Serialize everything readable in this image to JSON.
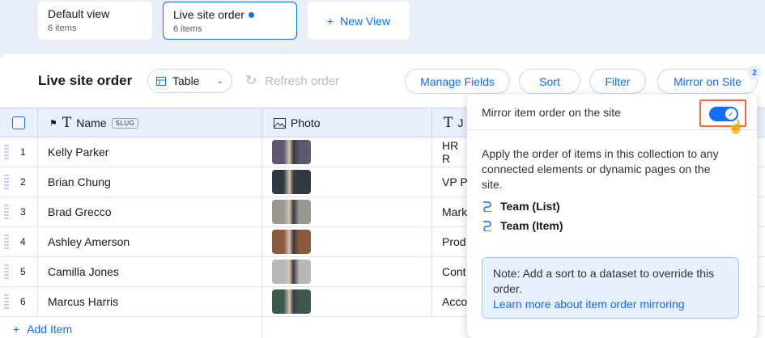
{
  "views": [
    {
      "name": "Default view",
      "count": "6 items",
      "active": false
    },
    {
      "name": "Live site order",
      "count": "6 items",
      "active": true
    }
  ],
  "new_view_label": "New View",
  "toolbar": {
    "title": "Live site order",
    "layout_select": "Table",
    "refresh_label": "Refresh order",
    "manage_fields": "Manage Fields",
    "sort": "Sort",
    "filter": "Filter",
    "mirror": "Mirror on Site",
    "mirror_badge": "2"
  },
  "columns": {
    "name": "Name",
    "slug_tag": "SLUG",
    "photo": "Photo",
    "third_partial": "J"
  },
  "rows": [
    {
      "num": "1",
      "name": "Kelly Parker",
      "third": "HR R",
      "photo_color": "#5d5770"
    },
    {
      "num": "2",
      "name": "Brian Chung",
      "third": "VP P",
      "photo_color": "#2f3a40"
    },
    {
      "num": "3",
      "name": "Brad Grecco",
      "third": "Mark",
      "photo_color": "#9a9690"
    },
    {
      "num": "4",
      "name": "Ashley Amerson",
      "third": "Prod",
      "photo_color": "#8a5a3c"
    },
    {
      "num": "5",
      "name": "Camilla Jones",
      "third": "Cont",
      "photo_color": "#b8b8b4"
    },
    {
      "num": "6",
      "name": "Marcus Harris",
      "third": "Acco",
      "photo_color": "#3c5a4c"
    }
  ],
  "add_item": "Add Item",
  "popover": {
    "toggle_label": "Mirror item order on the site",
    "description": "Apply the order of items in this collection to any connected elements or dynamic pages on the site.",
    "links": [
      "Team (List)",
      "Team (Item)"
    ],
    "note": "Note: Add a sort to a dataset to override this order.",
    "note_link": "Learn more about item order mirroring"
  },
  "colors": {
    "accent": "#116dff",
    "highlight": "#ef6a47"
  }
}
